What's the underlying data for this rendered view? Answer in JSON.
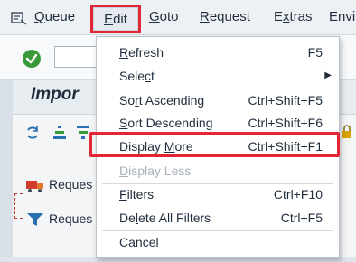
{
  "menubar": {
    "items": [
      {
        "label": "Queue",
        "mnemonic": "Q",
        "rest": "ueue"
      },
      {
        "label": "Edit",
        "mnemonic": "E",
        "rest": "dit"
      },
      {
        "label": "Goto",
        "mnemonic": "G",
        "rest": "oto"
      },
      {
        "label": "Request",
        "mnemonic": "R",
        "rest": "equest"
      },
      {
        "label": "Extras",
        "mnemonic": "x",
        "pre": "E",
        "rest": "tras"
      },
      {
        "label": "Envi",
        "mnemonic": "",
        "rest": "Envi"
      }
    ],
    "menu_icon": "menu-toggle-icon"
  },
  "toolbar": {
    "ok_icon": "checkmark-icon",
    "command_field_value": ""
  },
  "background": {
    "title": "Impor",
    "rows": [
      {
        "label": "Reques",
        "icon": "truck-icon"
      },
      {
        "label": "Reques",
        "icon": "filter-icon"
      }
    ]
  },
  "edit_menu": {
    "items": [
      {
        "pre": "",
        "u": "R",
        "post": "efresh",
        "shortcut": "F5",
        "enabled": true
      },
      {
        "pre": "Sele",
        "u": "c",
        "post": "t",
        "shortcut": "",
        "submenu": true,
        "enabled": true
      },
      {
        "pre": "So",
        "u": "r",
        "post": "t Ascending",
        "shortcut": "Ctrl+Shift+F5",
        "enabled": true
      },
      {
        "pre": "",
        "u": "S",
        "post": "ort Descending",
        "shortcut": "Ctrl+Shift+F6",
        "enabled": true
      },
      {
        "pre": "Display ",
        "u": "M",
        "post": "ore",
        "shortcut": "Ctrl+Shift+F1",
        "enabled": true
      },
      {
        "pre": "",
        "u": "D",
        "post": "isplay Less",
        "shortcut": "",
        "enabled": false
      },
      {
        "pre": "",
        "u": "F",
        "post": "ilters",
        "shortcut": "Ctrl+F10",
        "enabled": true
      },
      {
        "pre": "De",
        "u": "l",
        "post": "ete All Filters",
        "shortcut": "Ctrl+F5",
        "enabled": true
      },
      {
        "pre": "",
        "u": "C",
        "post": "ancel",
        "shortcut": "",
        "enabled": true
      }
    ]
  },
  "colors": {
    "highlight": "#e32636",
    "ok_green": "#3a9a3a",
    "icon_blue": "#2a6fb0"
  }
}
